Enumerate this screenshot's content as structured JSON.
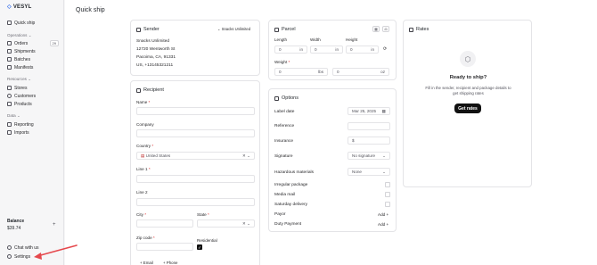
{
  "brand": {
    "name": "VESYL"
  },
  "sidebar": {
    "quick_ship": "Quick ship",
    "operations_label": "Operations",
    "orders": "Orders",
    "orders_count": "29",
    "shipments": "Shipments",
    "batches": "Batches",
    "manifests": "Manifests",
    "resources_label": "Resources",
    "stores": "Stores",
    "customers": "Customers",
    "products": "Products",
    "data_label": "Data",
    "reporting": "Reporting",
    "imports": "Imports",
    "balance_label": "Balance",
    "balance_value": "$39.74",
    "chat": "Chat with us",
    "settings": "Settings"
  },
  "page": {
    "title": "Quick ship"
  },
  "sender": {
    "title": "Sender",
    "selector": "Snacks Unlimited",
    "address_lines": [
      "Snacks Unlimited",
      "12720 Wentworth St",
      "Pacoima, CA, 91331",
      "US, +13145321211"
    ]
  },
  "recipient": {
    "title": "Recipient",
    "name_label": "Name",
    "company_label": "Company",
    "country_label": "Country",
    "country_value": "United States",
    "line1_label": "Line 1",
    "line2_label": "Line 2",
    "city_label": "City",
    "state_label": "State",
    "zip_label": "Zip code",
    "residential_label": "Residential",
    "email_btn": "+ Email",
    "phone_btn": "+ Phone"
  },
  "parcel": {
    "title": "Parcel",
    "length_label": "Length",
    "width_label": "Width",
    "height_label": "Height",
    "length_value": "0",
    "width_value": "0",
    "height_value": "0",
    "dim_unit": "in",
    "weight_label": "Weight",
    "weight_lbs": "0",
    "weight_oz": "0",
    "lbs_unit": "lbs",
    "oz_unit": "oz"
  },
  "options": {
    "title": "Options",
    "label_date": "Label date",
    "label_date_value": "Mar 25, 2025",
    "reference": "Reference",
    "insurance": "Insurance",
    "insurance_prefix": "$",
    "signature": "Signature",
    "signature_value": "No signature",
    "hazardous": "Hazardous materials",
    "hazardous_value": "None",
    "irregular": "Irregular package",
    "media": "Media mail",
    "saturday": "Saturday delivery",
    "payor": "Payor",
    "duty": "Duty Payment",
    "add": "Add"
  },
  "rates": {
    "title": "Rates",
    "heading": "Ready to ship?",
    "body_line1": "Fill in the sender, recipient and package details to",
    "body_line2": "get shipping rates",
    "button": "Get rates"
  },
  "colors": {
    "accent": "#2563eb",
    "arrow": "#e5484d"
  }
}
